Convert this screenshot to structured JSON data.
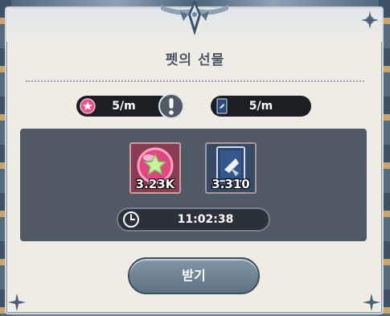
{
  "dialog": {
    "title": "펫의 선물"
  },
  "rates": [
    {
      "icon": "pink-star-orb-icon",
      "value": "5/m"
    },
    {
      "icon": "blue-card-icon",
      "value": "5/m"
    }
  ],
  "rewards": [
    {
      "icon": "pink-star-orb-icon",
      "count": "3.23K"
    },
    {
      "icon": "blue-card-icon",
      "count": "3.310"
    }
  ],
  "timer": {
    "icon": "clock-icon",
    "value": "11:02:38"
  },
  "claim_button": {
    "label": "받기"
  },
  "colors": {
    "panel": "#eeece4",
    "inner_box": "#515a64",
    "button": "#6f8596",
    "pill": "#1b1f24"
  }
}
